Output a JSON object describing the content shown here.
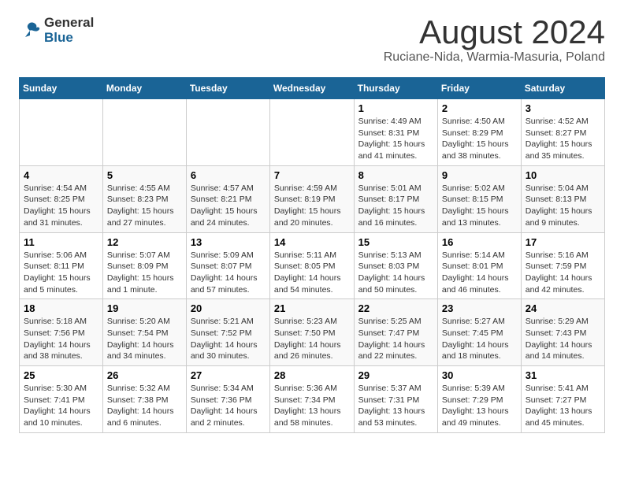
{
  "logo": {
    "line1": "General",
    "line2": "Blue"
  },
  "title": "August 2024",
  "subtitle": "Ruciane-Nida, Warmia-Masuria, Poland",
  "weekdays": [
    "Sunday",
    "Monday",
    "Tuesday",
    "Wednesday",
    "Thursday",
    "Friday",
    "Saturday"
  ],
  "weeks": [
    [
      {
        "day": "",
        "info": ""
      },
      {
        "day": "",
        "info": ""
      },
      {
        "day": "",
        "info": ""
      },
      {
        "day": "",
        "info": ""
      },
      {
        "day": "1",
        "info": "Sunrise: 4:49 AM\nSunset: 8:31 PM\nDaylight: 15 hours\nand 41 minutes."
      },
      {
        "day": "2",
        "info": "Sunrise: 4:50 AM\nSunset: 8:29 PM\nDaylight: 15 hours\nand 38 minutes."
      },
      {
        "day": "3",
        "info": "Sunrise: 4:52 AM\nSunset: 8:27 PM\nDaylight: 15 hours\nand 35 minutes."
      }
    ],
    [
      {
        "day": "4",
        "info": "Sunrise: 4:54 AM\nSunset: 8:25 PM\nDaylight: 15 hours\nand 31 minutes."
      },
      {
        "day": "5",
        "info": "Sunrise: 4:55 AM\nSunset: 8:23 PM\nDaylight: 15 hours\nand 27 minutes."
      },
      {
        "day": "6",
        "info": "Sunrise: 4:57 AM\nSunset: 8:21 PM\nDaylight: 15 hours\nand 24 minutes."
      },
      {
        "day": "7",
        "info": "Sunrise: 4:59 AM\nSunset: 8:19 PM\nDaylight: 15 hours\nand 20 minutes."
      },
      {
        "day": "8",
        "info": "Sunrise: 5:01 AM\nSunset: 8:17 PM\nDaylight: 15 hours\nand 16 minutes."
      },
      {
        "day": "9",
        "info": "Sunrise: 5:02 AM\nSunset: 8:15 PM\nDaylight: 15 hours\nand 13 minutes."
      },
      {
        "day": "10",
        "info": "Sunrise: 5:04 AM\nSunset: 8:13 PM\nDaylight: 15 hours\nand 9 minutes."
      }
    ],
    [
      {
        "day": "11",
        "info": "Sunrise: 5:06 AM\nSunset: 8:11 PM\nDaylight: 15 hours\nand 5 minutes."
      },
      {
        "day": "12",
        "info": "Sunrise: 5:07 AM\nSunset: 8:09 PM\nDaylight: 15 hours\nand 1 minute."
      },
      {
        "day": "13",
        "info": "Sunrise: 5:09 AM\nSunset: 8:07 PM\nDaylight: 14 hours\nand 57 minutes."
      },
      {
        "day": "14",
        "info": "Sunrise: 5:11 AM\nSunset: 8:05 PM\nDaylight: 14 hours\nand 54 minutes."
      },
      {
        "day": "15",
        "info": "Sunrise: 5:13 AM\nSunset: 8:03 PM\nDaylight: 14 hours\nand 50 minutes."
      },
      {
        "day": "16",
        "info": "Sunrise: 5:14 AM\nSunset: 8:01 PM\nDaylight: 14 hours\nand 46 minutes."
      },
      {
        "day": "17",
        "info": "Sunrise: 5:16 AM\nSunset: 7:59 PM\nDaylight: 14 hours\nand 42 minutes."
      }
    ],
    [
      {
        "day": "18",
        "info": "Sunrise: 5:18 AM\nSunset: 7:56 PM\nDaylight: 14 hours\nand 38 minutes."
      },
      {
        "day": "19",
        "info": "Sunrise: 5:20 AM\nSunset: 7:54 PM\nDaylight: 14 hours\nand 34 minutes."
      },
      {
        "day": "20",
        "info": "Sunrise: 5:21 AM\nSunset: 7:52 PM\nDaylight: 14 hours\nand 30 minutes."
      },
      {
        "day": "21",
        "info": "Sunrise: 5:23 AM\nSunset: 7:50 PM\nDaylight: 14 hours\nand 26 minutes."
      },
      {
        "day": "22",
        "info": "Sunrise: 5:25 AM\nSunset: 7:47 PM\nDaylight: 14 hours\nand 22 minutes."
      },
      {
        "day": "23",
        "info": "Sunrise: 5:27 AM\nSunset: 7:45 PM\nDaylight: 14 hours\nand 18 minutes."
      },
      {
        "day": "24",
        "info": "Sunrise: 5:29 AM\nSunset: 7:43 PM\nDaylight: 14 hours\nand 14 minutes."
      }
    ],
    [
      {
        "day": "25",
        "info": "Sunrise: 5:30 AM\nSunset: 7:41 PM\nDaylight: 14 hours\nand 10 minutes."
      },
      {
        "day": "26",
        "info": "Sunrise: 5:32 AM\nSunset: 7:38 PM\nDaylight: 14 hours\nand 6 minutes."
      },
      {
        "day": "27",
        "info": "Sunrise: 5:34 AM\nSunset: 7:36 PM\nDaylight: 14 hours\nand 2 minutes."
      },
      {
        "day": "28",
        "info": "Sunrise: 5:36 AM\nSunset: 7:34 PM\nDaylight: 13 hours\nand 58 minutes."
      },
      {
        "day": "29",
        "info": "Sunrise: 5:37 AM\nSunset: 7:31 PM\nDaylight: 13 hours\nand 53 minutes."
      },
      {
        "day": "30",
        "info": "Sunrise: 5:39 AM\nSunset: 7:29 PM\nDaylight: 13 hours\nand 49 minutes."
      },
      {
        "day": "31",
        "info": "Sunrise: 5:41 AM\nSunset: 7:27 PM\nDaylight: 13 hours\nand 45 minutes."
      }
    ]
  ]
}
